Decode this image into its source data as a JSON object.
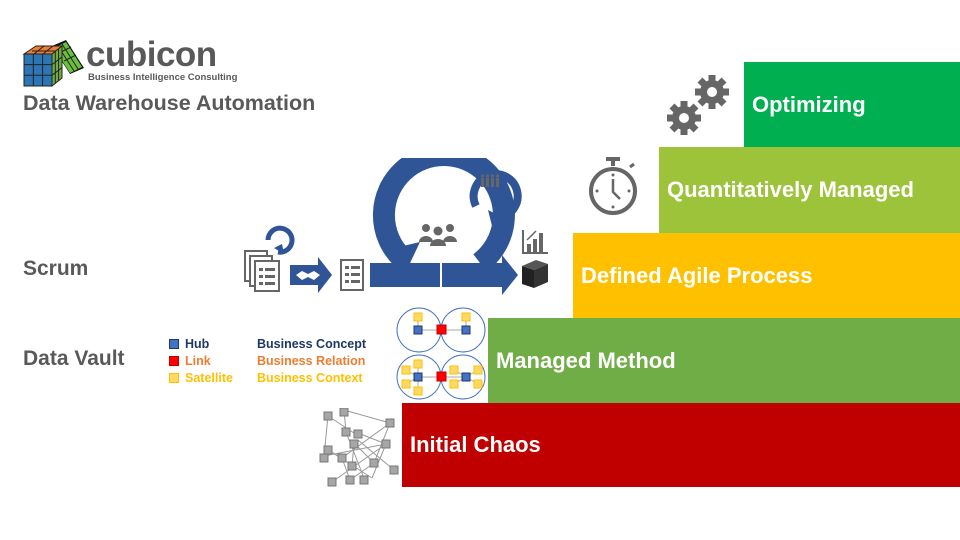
{
  "brand": {
    "name": "cubicon",
    "tagline": "Business Intelligence Consulting",
    "logo_icon": "rubiks-cube-icon"
  },
  "title": "Data Warehouse Automation",
  "side_labels": {
    "scrum": "Scrum",
    "data_vault": "Data Vault"
  },
  "legend": [
    {
      "key": "Hub",
      "meaning": "Business Concept",
      "key_color": "#1f3864",
      "meaning_color": "#1f3864",
      "swatch": "#4472c4"
    },
    {
      "key": "Link",
      "meaning": "Business Relation",
      "key_color": "#ed7d31",
      "meaning_color": "#ed7d31",
      "swatch": "#ff0000"
    },
    {
      "key": "Satellite",
      "meaning": "Business Context",
      "key_color": "#ffc000",
      "meaning_color": "#ffc000",
      "swatch": "#ffd966"
    }
  ],
  "steps": [
    {
      "level": 5,
      "label": "Optimizing",
      "color": "#00b050",
      "icon": "gears-icon"
    },
    {
      "level": 4,
      "label": "Quantitatively Managed",
      "color": "#9dc33b",
      "icon": "stopwatch-icon"
    },
    {
      "level": 3,
      "label": "Defined Agile Process",
      "color": "#ffc000",
      "icon": "scrum-cycle-icon"
    },
    {
      "level": 2,
      "label": "Managed Method",
      "color": "#70ad47",
      "icon": "data-vault-model-icon"
    },
    {
      "level": 1,
      "label": "Initial Chaos",
      "color": "#c00000",
      "icon": "chaos-network-icon"
    }
  ],
  "colors": {
    "text_gray": "#595959",
    "scrum_blue": "#2f5597",
    "icon_gray": "#666666"
  }
}
